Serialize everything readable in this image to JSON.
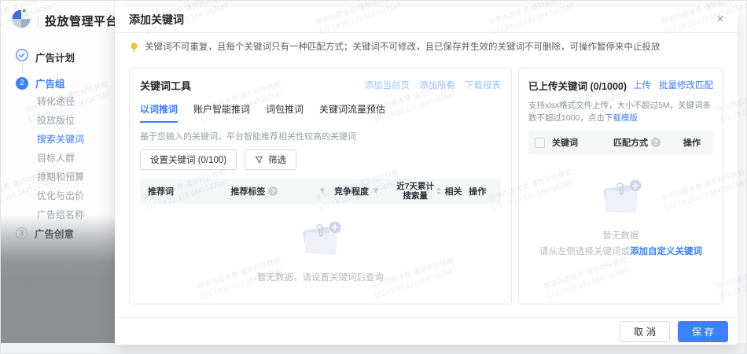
{
  "sidebar": {
    "brand_title": "投放管理平台",
    "step1_label": "广告计划",
    "step2_num": "2",
    "step2_label": "广告组",
    "step2_items": [
      {
        "label": "转化途径"
      },
      {
        "label": "投放版位"
      },
      {
        "label": "搜索关键词"
      },
      {
        "label": "目标人群"
      },
      {
        "label": "排期和预算"
      },
      {
        "label": "优化与出价"
      },
      {
        "label": "广告组名称"
      }
    ],
    "step3_num": "3",
    "step3_label": "广告创意"
  },
  "modal": {
    "title": "添加关键词",
    "alert": "关键词不可重复，且每个关键词只有一种匹配方式；关键词不可修改，且已保存并生效的关键词不可删除，可操作暂停来中止投放",
    "left": {
      "title": "关键词工具",
      "links": [
        {
          "label": "添加当前页"
        },
        {
          "label": "添加所有"
        },
        {
          "label": "下载报表"
        }
      ],
      "tabs": [
        {
          "label": "以词推词"
        },
        {
          "label": "账户智能推词"
        },
        {
          "label": "词包推词"
        },
        {
          "label": "关键词流量预估"
        }
      ],
      "desc": "基于您输入的关键词，平台智能推荐相关性较高的关键词",
      "set_button": "设置关键词 (0/100)",
      "filter_button": "筛选",
      "col_word": "推荐词",
      "col_tag": "推荐标签",
      "col_compete": "竞争程度",
      "col_search_line1": "近7天累计",
      "col_search_line2": "搜索量",
      "col_related": "相关",
      "col_action": "操作",
      "empty_text": "暂无数据，请设置关键词后查询"
    },
    "right": {
      "title": "已上传关键词 (0/1000)",
      "links": [
        {
          "label": "上传"
        },
        {
          "label": "批量修改匹配"
        }
      ],
      "desc": "支持xlsx格式文件上传，大小不超过5M，关键词条数不超过1000，点击",
      "template_link": "下载模版",
      "col_word": "关键词",
      "col_match": "匹配方式",
      "col_action": "操作",
      "empty_title": "暂无数据",
      "empty_prefix": "请从左侧选择关键词或",
      "empty_link": "添加自定义关键词"
    },
    "footer": {
      "cancel": "取消",
      "save": "保存"
    }
  },
  "icons": {
    "close": "×",
    "help": "?"
  },
  "watermark": {
    "line1": "快手内部信息 请勿对外转载",
    "line2": "172.19.22.121 1647347587"
  },
  "colors": {
    "accent": "#3d7fff",
    "disabled_link": "#9dc4fd",
    "warning": "#f6bd3a",
    "dim": "#8d8f93"
  }
}
